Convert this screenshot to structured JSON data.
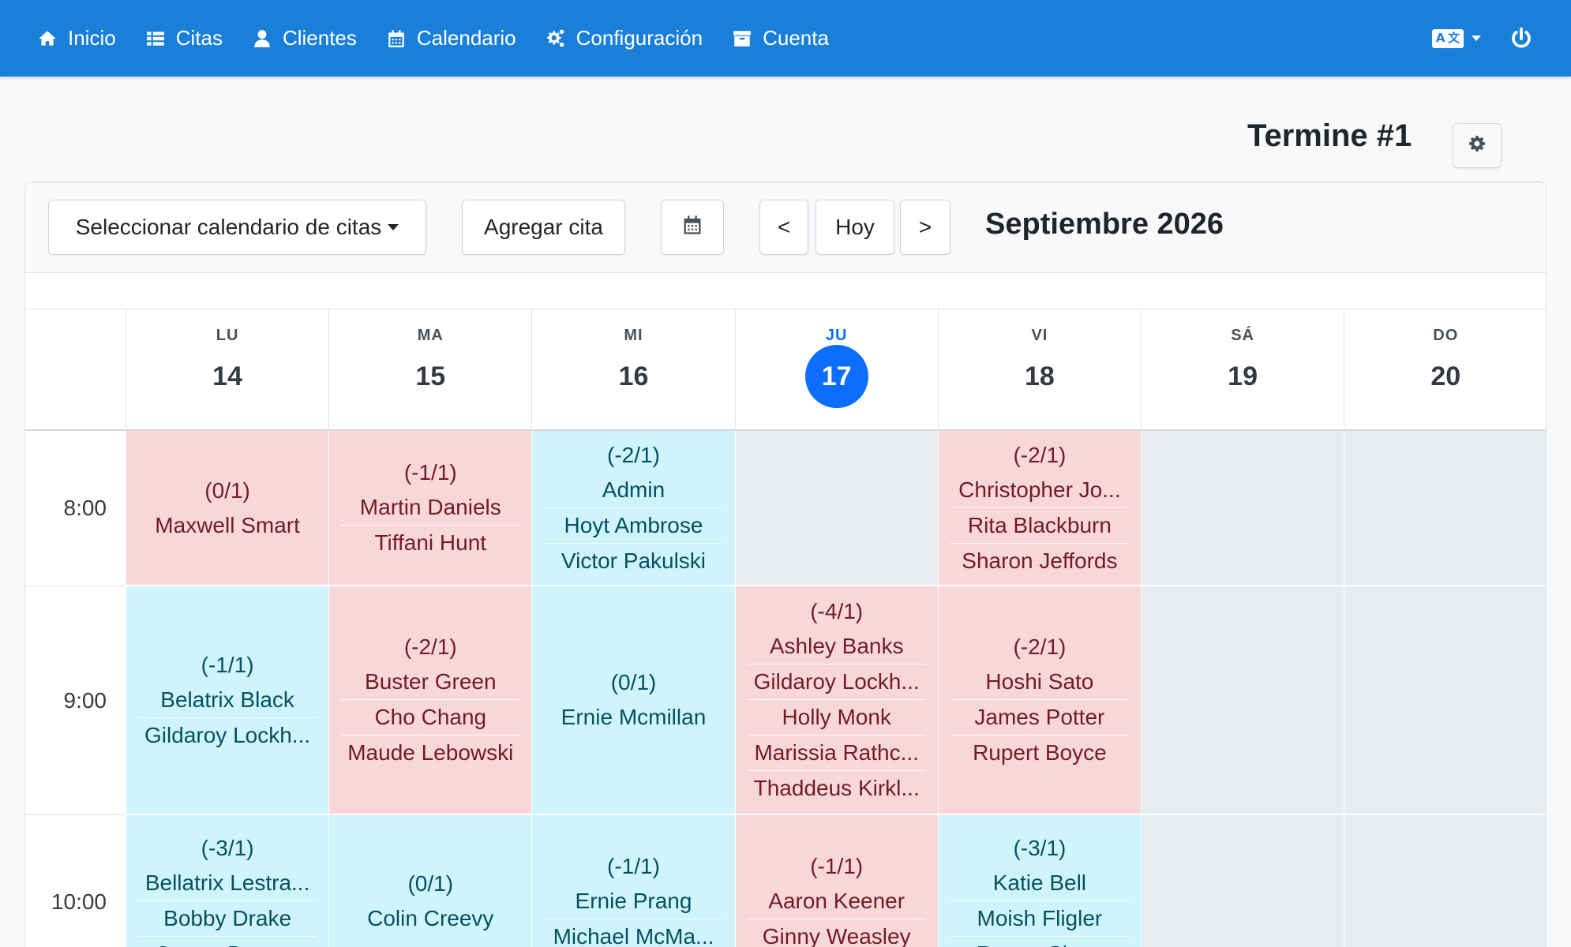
{
  "nav": {
    "items": [
      {
        "label": "Inicio",
        "icon": "home-icon"
      },
      {
        "label": "Citas",
        "icon": "list-icon"
      },
      {
        "label": "Clientes",
        "icon": "user-icon"
      },
      {
        "label": "Calendario",
        "icon": "calendar-icon"
      },
      {
        "label": "Configuración",
        "icon": "cogs-icon"
      },
      {
        "label": "Cuenta",
        "icon": "archive-icon"
      }
    ],
    "language_icon": "language-icon",
    "power_icon": "power-icon",
    "bar_color": "#1a7fd9"
  },
  "page": {
    "title": "Termine #1",
    "settings_icon": "gear-icon"
  },
  "toolbar": {
    "select_calendar_label": "Seleccionar calendario de citas",
    "add_appointment_label": "Agregar cita",
    "date_picker_icon": "calendar-icon",
    "prev_label": "<",
    "today_label": "Hoy",
    "next_label": ">",
    "month_title": "Septiembre 2026"
  },
  "days": [
    {
      "name": "LU",
      "date": "14",
      "today": false
    },
    {
      "name": "MA",
      "date": "15",
      "today": false
    },
    {
      "name": "MI",
      "date": "16",
      "today": false
    },
    {
      "name": "JU",
      "date": "17",
      "today": true
    },
    {
      "name": "VI",
      "date": "18",
      "today": false
    },
    {
      "name": "SÁ",
      "date": "19",
      "today": false
    },
    {
      "name": "DO",
      "date": "20",
      "today": false
    }
  ],
  "rows": [
    {
      "time": "8:00",
      "cells": [
        {
          "status": "red",
          "count": "(0/1)",
          "names": [
            "Maxwell Smart"
          ]
        },
        {
          "status": "red",
          "count": "(-1/1)",
          "names": [
            "Martin Daniels",
            "Tiffani Hunt"
          ]
        },
        {
          "status": "cyan",
          "count": "(-2/1)",
          "names": [
            "Admin",
            "Hoyt Ambrose",
            "Victor Pakulski"
          ]
        },
        {
          "status": "empty",
          "count": "",
          "names": []
        },
        {
          "status": "red",
          "count": "(-2/1)",
          "names": [
            "Christopher Jo...",
            "Rita Blackburn",
            "Sharon Jeffords"
          ]
        },
        {
          "status": "empty",
          "count": "",
          "names": []
        },
        {
          "status": "empty",
          "count": "",
          "names": []
        }
      ]
    },
    {
      "time": "9:00",
      "cells": [
        {
          "status": "cyan",
          "count": "(-1/1)",
          "names": [
            "Belatrix Black",
            "Gildaroy Lockh..."
          ]
        },
        {
          "status": "red",
          "count": "(-2/1)",
          "names": [
            "Buster Green",
            "Cho Chang",
            "Maude Lebowski"
          ]
        },
        {
          "status": "cyan",
          "count": "(0/1)",
          "names": [
            "Ernie Mcmillan"
          ]
        },
        {
          "status": "red",
          "count": "(-4/1)",
          "names": [
            "Ashley Banks",
            "Gildaroy Lockh...",
            "Holly Monk",
            "Marissia Rathc...",
            "Thaddeus Kirkl..."
          ]
        },
        {
          "status": "red",
          "count": "(-2/1)",
          "names": [
            "Hoshi Sato",
            "James Potter",
            "Rupert Boyce"
          ]
        },
        {
          "status": "empty",
          "count": "",
          "names": []
        },
        {
          "status": "empty",
          "count": "",
          "names": []
        }
      ]
    },
    {
      "time": "10:00",
      "cells": [
        {
          "status": "cyan",
          "count": "(-3/1)",
          "names": [
            "Bellatrix Lestra...",
            "Bobby Drake",
            "James Dragov"
          ]
        },
        {
          "status": "cyan",
          "count": "(0/1)",
          "names": [
            "Colin Creevy"
          ]
        },
        {
          "status": "cyan",
          "count": "(-1/1)",
          "names": [
            "Ernie Prang",
            "Michael McMa..."
          ]
        },
        {
          "status": "red",
          "count": "(-1/1)",
          "names": [
            "Aaron Keener",
            "Ginny Weasley"
          ]
        },
        {
          "status": "cyan",
          "count": "(-3/1)",
          "names": [
            "Katie Bell",
            "Moish Fligler",
            "Regan Shaw"
          ]
        },
        {
          "status": "empty",
          "count": "",
          "names": []
        },
        {
          "status": "empty",
          "count": "",
          "names": []
        }
      ]
    }
  ],
  "colors": {
    "overbooked": "#f8d7da",
    "available": "#cff4fc",
    "closed": "#e9ecef",
    "today_accent": "#0d6efd"
  }
}
